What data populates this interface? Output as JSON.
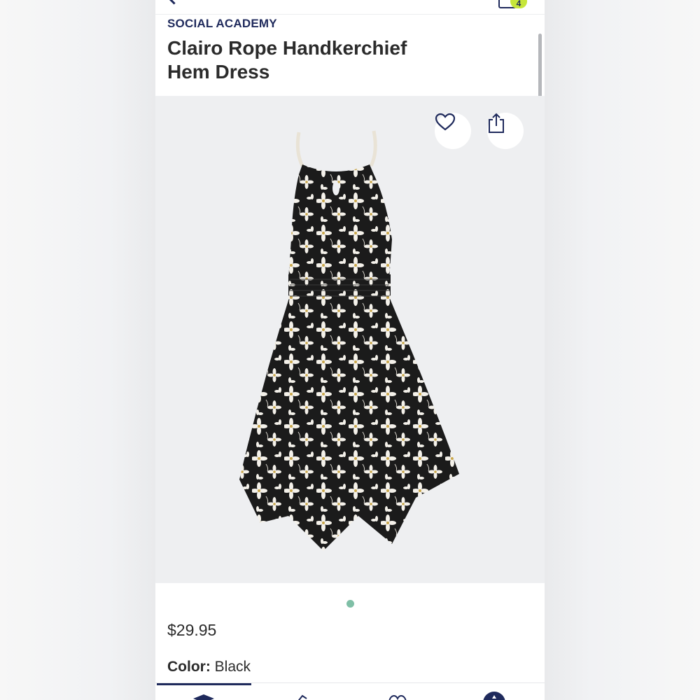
{
  "header": {
    "cart_count": "4"
  },
  "product": {
    "brand": "SOCIAL ACADEMY",
    "title_line1": "Clairo Rope Handkerchief",
    "title_line2": "Hem Dress",
    "price": "$29.95",
    "color_label": "Color:",
    "color_value": "Black"
  },
  "gallery": {
    "image_count": 1,
    "active_index": 0
  },
  "icons": {
    "back": "chevron-left-icon",
    "cart": "shopping-bag-icon",
    "favorite": "heart-icon",
    "share": "share-icon",
    "tab_home": "graduation-cap-icon",
    "tab_shop": "tag-icon",
    "tab_favorites": "heart-icon",
    "tab_account": "account-icon"
  },
  "colors": {
    "brand_navy": "#1f2a5c",
    "badge": "#c6e63a",
    "page_dot": "#7fbfa6",
    "hero_bg": "#eeeff1"
  }
}
